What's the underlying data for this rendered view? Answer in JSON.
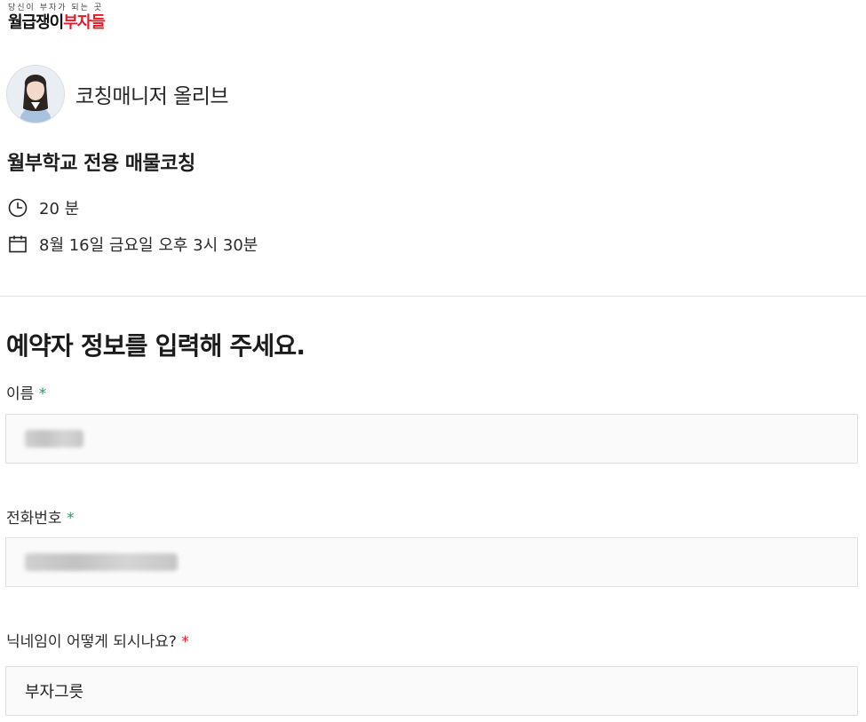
{
  "brand": {
    "tagline": "당신이 부자가 되는 곳",
    "name_part1": "월급쟁이",
    "name_part2": "부자들",
    "accent_color": "#e11d2a"
  },
  "host": {
    "name": "코칭매니저 올리브",
    "avatar_icon": "profile-photo"
  },
  "event": {
    "title": "월부학교 전용 매물코칭",
    "duration": "20 분",
    "duration_icon": "clock-icon",
    "datetime": "8월 16일 금요일 오후 3시 30분",
    "datetime_icon": "calendar-icon"
  },
  "form": {
    "heading": "예약자 정보를 입력해 주세요.",
    "fields": [
      {
        "label": "이름",
        "required_mark": "*",
        "required_color": "#1f9e5a",
        "value": "",
        "value_obscured": true
      },
      {
        "label": "전화번호",
        "required_mark": "*",
        "required_color": "#1f9e5a",
        "value": "",
        "value_obscured": true
      },
      {
        "label": "닉네임이 어떻게 되시나요?",
        "required_mark": "*",
        "required_color": "#e11d2a",
        "value": "부자그릇",
        "value_obscured": false
      }
    ]
  }
}
